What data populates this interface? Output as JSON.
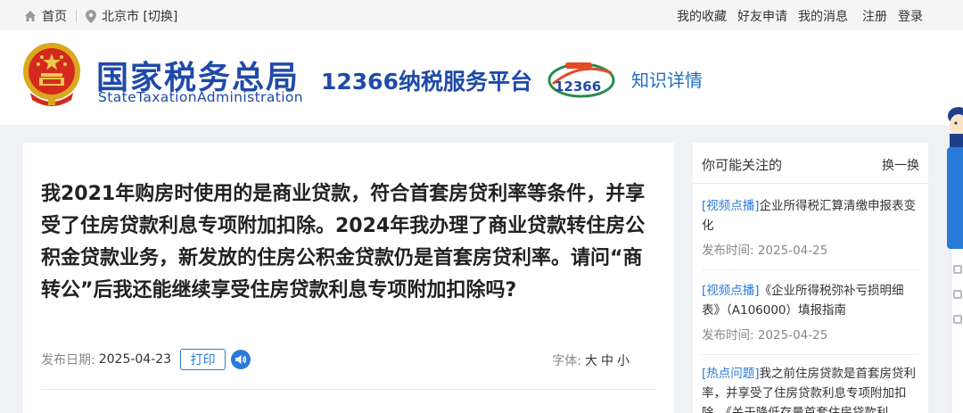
{
  "topbar": {
    "home": "首页",
    "city": "北京市 [切换]",
    "links": [
      "我的收藏",
      "好友申请",
      "我的消息"
    ],
    "register": "注册",
    "login": "登录"
  },
  "header": {
    "brand_cn": "国家税务总局",
    "brand_en": "StateTaxationAdministration",
    "service_name": "12366纳税服务平台",
    "section": "知识详情",
    "logo_digits": "12366"
  },
  "article": {
    "title": "我2021年购房时使用的是商业贷款，符合首套房贷利率等条件，并享受了住房贷款利息专项附加扣除。2024年我办理了商业贷款转住房公积金贷款业务，新发放的住房公积金贷款仍是首套房贷利率。请问“商转公”后我还能继续享受住房贷款利息专项附加扣除吗?",
    "date_label": "发布日期:",
    "date": "2025-04-23",
    "print_label": "打印",
    "font_label": "字体:",
    "font_sizes": [
      "大",
      "中",
      "小"
    ]
  },
  "sidebar": {
    "title": "你可能关注的",
    "refresh": "换一换",
    "items": [
      {
        "tag": "[视频点播]",
        "text": "企业所得税汇算清缴申报表变化",
        "time": "发布时间:  2025-04-25"
      },
      {
        "tag": "[视频点播]",
        "text": "《企业所得税弥补亏损明细表》（A106000）填报指南",
        "time": "发布时间:  2025-04-25"
      },
      {
        "tag": "[热点问题]",
        "text": "我之前住房贷款是首套房贷利率，并享受了住房贷款利息专项附加扣除。《关于降低存量首套住房贷款利",
        "time": ""
      }
    ]
  },
  "colors": {
    "brand_blue": "#1f4aa8",
    "accent_blue": "#2a7ad9",
    "page_bg": "#f1f2f5"
  }
}
